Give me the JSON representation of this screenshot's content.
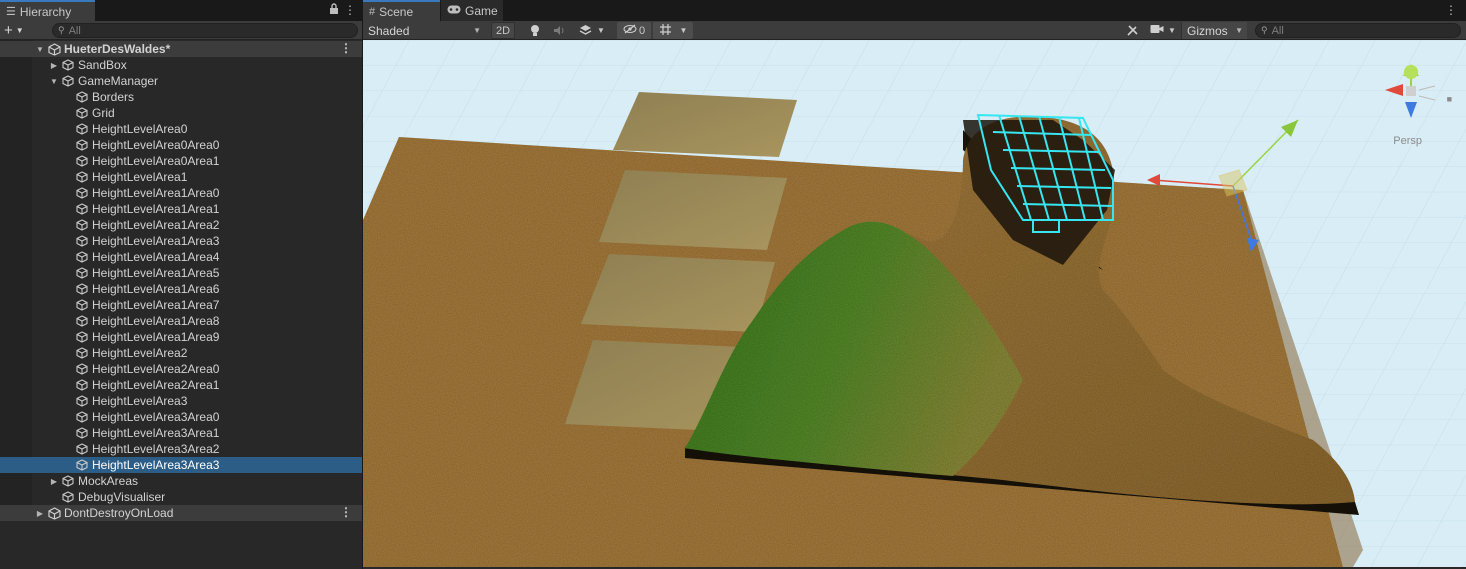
{
  "hierarchy": {
    "tab_label": "Hierarchy",
    "search_placeholder": "All",
    "scene_name": "HueterDesWaldes*",
    "dontdestroy_name": "DontDestroyOnLoad",
    "items": [
      {
        "label": "SandBox",
        "depth": 1,
        "arrow": "right"
      },
      {
        "label": "GameManager",
        "depth": 1,
        "arrow": "down"
      },
      {
        "label": "Borders",
        "depth": 2,
        "arrow": ""
      },
      {
        "label": "Grid",
        "depth": 2,
        "arrow": ""
      },
      {
        "label": "HeightLevelArea0",
        "depth": 2,
        "arrow": ""
      },
      {
        "label": "HeightLevelArea0Area0",
        "depth": 2,
        "arrow": ""
      },
      {
        "label": "HeightLevelArea0Area1",
        "depth": 2,
        "arrow": ""
      },
      {
        "label": "HeightLevelArea1",
        "depth": 2,
        "arrow": ""
      },
      {
        "label": "HeightLevelArea1Area0",
        "depth": 2,
        "arrow": ""
      },
      {
        "label": "HeightLevelArea1Area1",
        "depth": 2,
        "arrow": ""
      },
      {
        "label": "HeightLevelArea1Area2",
        "depth": 2,
        "arrow": ""
      },
      {
        "label": "HeightLevelArea1Area3",
        "depth": 2,
        "arrow": ""
      },
      {
        "label": "HeightLevelArea1Area4",
        "depth": 2,
        "arrow": ""
      },
      {
        "label": "HeightLevelArea1Area5",
        "depth": 2,
        "arrow": ""
      },
      {
        "label": "HeightLevelArea1Area6",
        "depth": 2,
        "arrow": ""
      },
      {
        "label": "HeightLevelArea1Area7",
        "depth": 2,
        "arrow": ""
      },
      {
        "label": "HeightLevelArea1Area8",
        "depth": 2,
        "arrow": ""
      },
      {
        "label": "HeightLevelArea1Area9",
        "depth": 2,
        "arrow": ""
      },
      {
        "label": "HeightLevelArea2",
        "depth": 2,
        "arrow": ""
      },
      {
        "label": "HeightLevelArea2Area0",
        "depth": 2,
        "arrow": ""
      },
      {
        "label": "HeightLevelArea2Area1",
        "depth": 2,
        "arrow": ""
      },
      {
        "label": "HeightLevelArea3",
        "depth": 2,
        "arrow": ""
      },
      {
        "label": "HeightLevelArea3Area0",
        "depth": 2,
        "arrow": ""
      },
      {
        "label": "HeightLevelArea3Area1",
        "depth": 2,
        "arrow": ""
      },
      {
        "label": "HeightLevelArea3Area2",
        "depth": 2,
        "arrow": ""
      },
      {
        "label": "HeightLevelArea3Area3",
        "depth": 2,
        "arrow": "",
        "selected": true
      },
      {
        "label": "MockAreas",
        "depth": 1,
        "arrow": "right"
      },
      {
        "label": "DebugVisualiser",
        "depth": 1,
        "arrow": ""
      }
    ]
  },
  "scene": {
    "tab_scene": "Scene",
    "tab_game": "Game",
    "shading_mode": "Shaded",
    "btn_2d": "2D",
    "hidden_count": "0",
    "gizmos_label": "Gizmos",
    "search_placeholder": "All",
    "persp_label": "Persp"
  },
  "icons": {
    "hierarchy_tab": "hierarchy-list-icon",
    "scene_tab": "grid-icon",
    "game_tab": "gamepad-icon",
    "lock": "lock-icon",
    "menu": "kebab-menu-icon"
  },
  "colors": {
    "selection": "#2c5d87",
    "tab_accent": "#3a79bb",
    "grid_sky": "#d6ecf5",
    "ground": "#a47a3c",
    "grass": "#4b8a2a",
    "wire": "#37e6f0"
  }
}
